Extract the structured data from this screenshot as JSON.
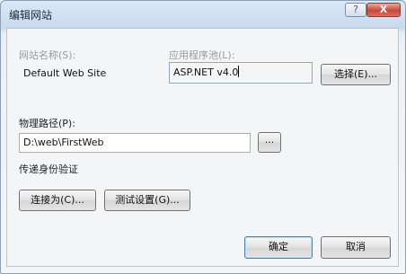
{
  "window": {
    "title": "编辑网站",
    "help_glyph": "?",
    "close_glyph": "X"
  },
  "site_name": {
    "label": "网站名称(S):",
    "value": "Default Web Site"
  },
  "app_pool": {
    "label": "应用程序池(L):",
    "value": "ASP.NET v4.0",
    "select_label": "选择(E)..."
  },
  "physical_path": {
    "label": "物理路径(P):",
    "value": "D:\\web\\FirstWeb",
    "browse_label": "..."
  },
  "pass_through_auth": {
    "label": "传递身份验证"
  },
  "auth_buttons": {
    "connect_as_label": "连接为(C)...",
    "test_settings_label": "测试设置(G)..."
  },
  "footer": {
    "ok_label": "确定",
    "cancel_label": "取消"
  }
}
